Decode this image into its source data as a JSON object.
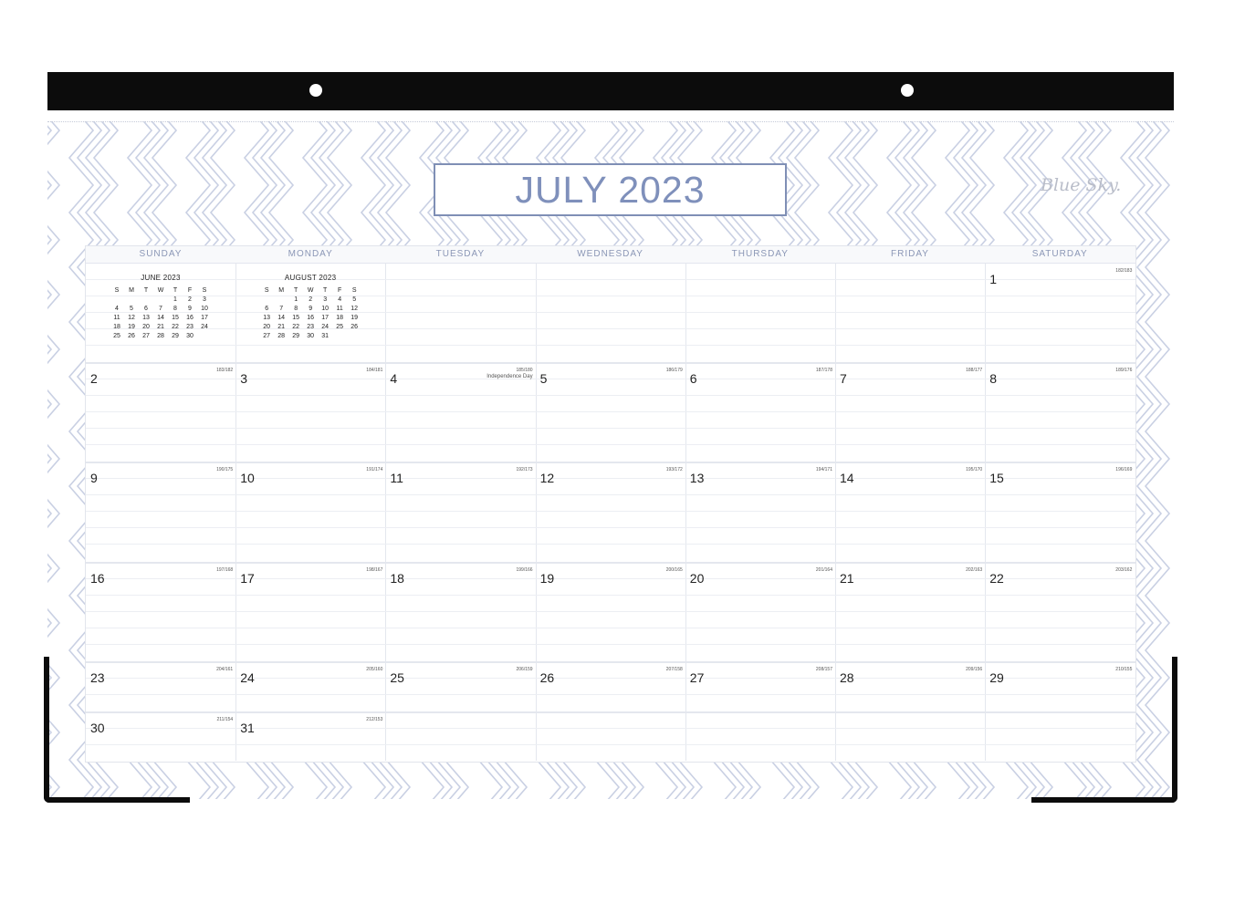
{
  "calendar": {
    "title": "JULY 2023",
    "brand": "Blue Sky.",
    "weekdays": [
      "SUNDAY",
      "MONDAY",
      "TUESDAY",
      "WEDNESDAY",
      "THURSDAY",
      "FRIDAY",
      "SATURDAY"
    ],
    "mini_calendars": [
      {
        "title": "JUNE 2023",
        "header": [
          "S",
          "M",
          "T",
          "W",
          "T",
          "F",
          "S"
        ],
        "weeks": [
          [
            "",
            "",
            "",
            "",
            "1",
            "2",
            "3"
          ],
          [
            "4",
            "5",
            "6",
            "7",
            "8",
            "9",
            "10"
          ],
          [
            "11",
            "12",
            "13",
            "14",
            "15",
            "16",
            "17"
          ],
          [
            "18",
            "19",
            "20",
            "21",
            "22",
            "23",
            "24"
          ],
          [
            "25",
            "26",
            "27",
            "28",
            "29",
            "30",
            ""
          ]
        ]
      },
      {
        "title": "AUGUST 2023",
        "header": [
          "S",
          "M",
          "T",
          "W",
          "T",
          "F",
          "S"
        ],
        "weeks": [
          [
            "",
            "",
            "1",
            "2",
            "3",
            "4",
            "5"
          ],
          [
            "6",
            "7",
            "8",
            "9",
            "10",
            "11",
            "12"
          ],
          [
            "13",
            "14",
            "15",
            "16",
            "17",
            "18",
            "19"
          ],
          [
            "20",
            "21",
            "22",
            "23",
            "24",
            "25",
            "26"
          ],
          [
            "27",
            "28",
            "29",
            "30",
            "31",
            "",
            ""
          ]
        ]
      }
    ],
    "days": [
      {
        "day": "1",
        "count": "182/183"
      },
      {
        "day": "2",
        "count": "183/182"
      },
      {
        "day": "3",
        "count": "184/181"
      },
      {
        "day": "4",
        "count": "185/180",
        "holiday": "Independence Day"
      },
      {
        "day": "5",
        "count": "186/179"
      },
      {
        "day": "6",
        "count": "187/178"
      },
      {
        "day": "7",
        "count": "188/177"
      },
      {
        "day": "8",
        "count": "189/176"
      },
      {
        "day": "9",
        "count": "190/175"
      },
      {
        "day": "10",
        "count": "191/174"
      },
      {
        "day": "11",
        "count": "192/173"
      },
      {
        "day": "12",
        "count": "193/172"
      },
      {
        "day": "13",
        "count": "194/171"
      },
      {
        "day": "14",
        "count": "195/170"
      },
      {
        "day": "15",
        "count": "196/169"
      },
      {
        "day": "16",
        "count": "197/168"
      },
      {
        "day": "17",
        "count": "198/167"
      },
      {
        "day": "18",
        "count": "199/166"
      },
      {
        "day": "19",
        "count": "200/165"
      },
      {
        "day": "20",
        "count": "201/164"
      },
      {
        "day": "21",
        "count": "202/163"
      },
      {
        "day": "22",
        "count": "203/162"
      },
      {
        "day": "23",
        "count": "204/161"
      },
      {
        "day": "24",
        "count": "205/160"
      },
      {
        "day": "25",
        "count": "206/159"
      },
      {
        "day": "26",
        "count": "207/158"
      },
      {
        "day": "27",
        "count": "208/157"
      },
      {
        "day": "28",
        "count": "209/156"
      },
      {
        "day": "29",
        "count": "210/155"
      },
      {
        "day": "30",
        "count": "211/154"
      },
      {
        "day": "31",
        "count": "212/153"
      }
    ]
  },
  "colors": {
    "binding": "#0c0c0c",
    "accent": "#7f90bb",
    "pattern": "#c9d0e3",
    "grid_line": "#e4e7ee"
  }
}
